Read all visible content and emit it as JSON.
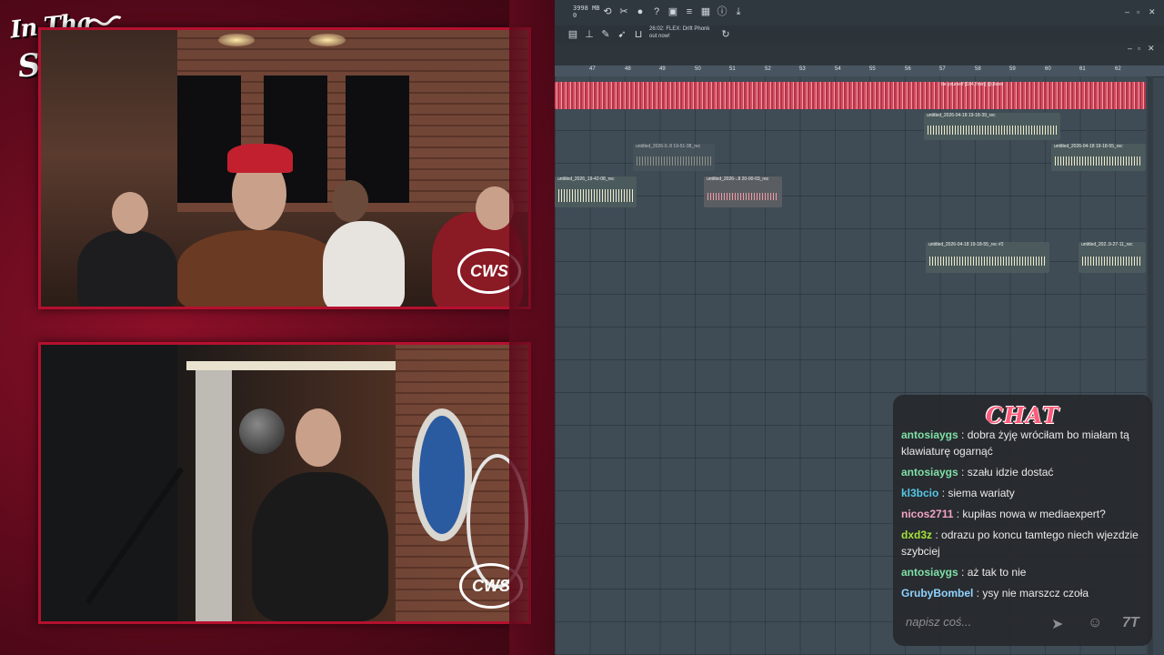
{
  "overlay": {
    "brand": {
      "line1": "In Tha",
      "line2": "Studio!"
    },
    "watermark": "CWS"
  },
  "daw": {
    "memory": [
      "3998 MB",
      "0"
    ],
    "hint": [
      "26:02: FLEX: Drift Phonk",
      "out now!"
    ],
    "ruler": [
      "47",
      "48",
      "49",
      "50",
      "51",
      "52",
      "53",
      "54",
      "55",
      "56",
      "57",
      "58",
      "59",
      "60",
      "61",
      "62"
    ],
    "clips": {
      "main": "be yourself [164,7min] @Jbore",
      "rec1": "untitled_2026-04-18 19-18-39_rec",
      "rec2": "untitled_2026-0..8 19-51-38_rec",
      "rec3": "untitled_2026-04-18 19-18-55_rec",
      "rec4": "untitled_2026_19-42-08_rec",
      "rec5": "untitled_2026-..8 20-00-03_rec",
      "rec6": "untitled_2026-04-18 19-18-55_rec #2",
      "rec7": "untitled_202..9-27-11_rec"
    }
  },
  "chat": {
    "title": "CHAT",
    "messages": [
      {
        "user": "antosiaygs",
        "color": "#7fe0a7",
        "text": "dobra żyję wróciłam bo miałam tą klawiaturę ogarnąć"
      },
      {
        "user": "antosiaygs",
        "color": "#7fe0a7",
        "text": "szału idzie dostać"
      },
      {
        "user": "kl3bcio",
        "color": "#55c7e6",
        "text": "siema wariaty"
      },
      {
        "user": "nicos2711",
        "color": "#f2a3c7",
        "text": "kupiłas nowa w mediaexpert?"
      },
      {
        "user": "dxd3z",
        "color": "#a6e33a",
        "text": "odrazu po koncu tamtego niech wjezdzie szybciej"
      },
      {
        "user": "antosiaygs",
        "color": "#7fe0a7",
        "text": "aż tak to nie"
      },
      {
        "user": "GrubyBombel",
        "color": "#8fd3ff",
        "text": "ysy nie marszcz czoła"
      }
    ],
    "input_placeholder": "napisz coś...",
    "icons": [
      "send-icon",
      "emoji-icon",
      "7tv-icon"
    ],
    "emote_label": "7T"
  }
}
